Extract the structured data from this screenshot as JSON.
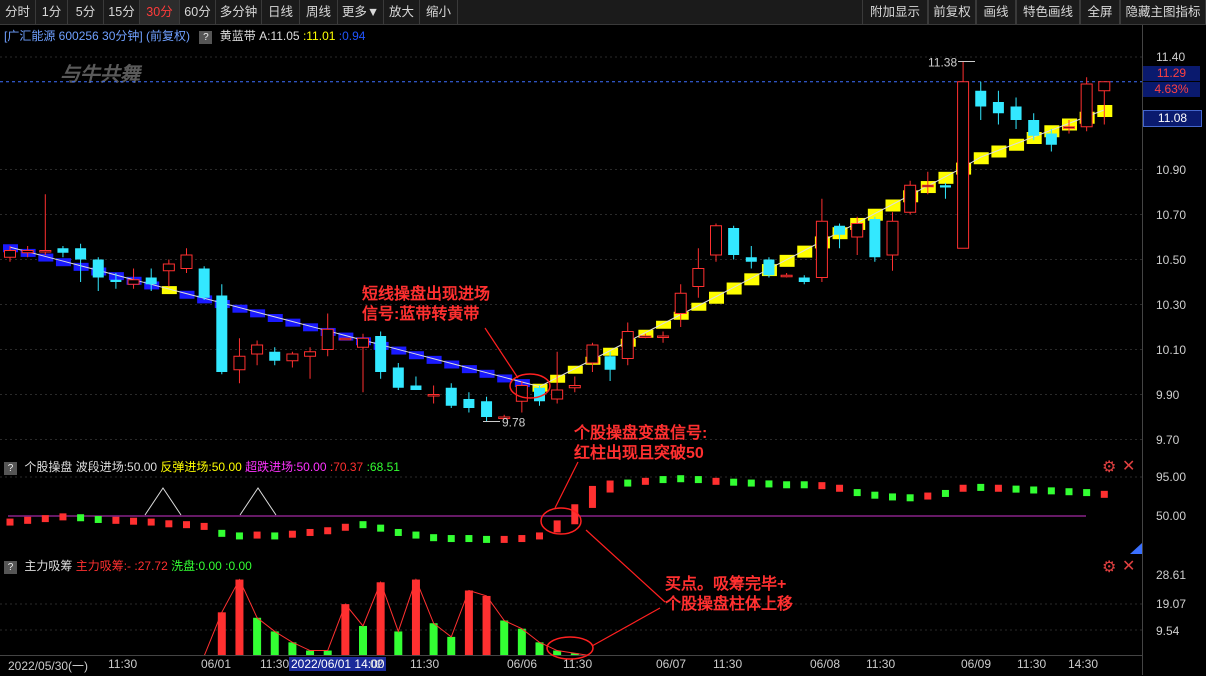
{
  "toolbar": {
    "left": [
      "分时",
      "1分",
      "5分",
      "15分",
      "30分",
      "60分",
      "多分钟",
      "日线",
      "周线",
      "更多▼",
      "放大",
      "缩小"
    ],
    "right": [
      "附加显示",
      "前复权",
      "画线",
      "特色画线",
      "全屏",
      "隐藏主图指标"
    ],
    "active": "30分"
  },
  "main": {
    "stock_label": "[广汇能源 600256 30分钟] (前复权)",
    "indicator_name": "黄蓝带",
    "indicator_a": "A:11.05",
    "indicator_b": ":11.01",
    "indicator_c": ":0.94",
    "watermark": "与牛共舞",
    "high_label": "11.38",
    "low_label": "9.78",
    "annotation": [
      "短线操盘出现进场",
      "信号:蓝带转黄带"
    ]
  },
  "price_axis": {
    "ticks": [
      "11.40",
      "10.90",
      "10.70",
      "10.50",
      "10.30",
      "10.10",
      "9.90",
      "9.70"
    ],
    "current_price": "11.29",
    "current_pct": "4.63%",
    "cursor_price": "11.08"
  },
  "sub1": {
    "name": "个股操盘",
    "l1": "波段进场:50.00",
    "l2": "反弹进场:50.00",
    "l3": "超跌进场:50.00",
    "l4": ":70.37",
    "l5": ":68.51",
    "ticks": [
      "95.00",
      "50.00"
    ],
    "annotation": [
      "个股操盘变盘信号:",
      "红柱出现且突破50"
    ]
  },
  "sub2": {
    "name": "主力吸筹",
    "l1": "主力吸筹:-",
    "l2": ":27.72",
    "l3": "洗盘:0.00",
    "l4": ":0.00",
    "ticks": [
      "28.61",
      "19.07",
      "9.54"
    ],
    "annotation": [
      "买点。吸筹完毕+",
      "个股操盘柱体上移"
    ]
  },
  "dates": [
    "2022/05/30(一)",
    "11:30",
    "06/01",
    "11:30",
    "2022/06/01 14:00",
    "02",
    "11:30",
    "06/06",
    "11:30",
    "06/07",
    "11:30",
    "06/08",
    "11:30",
    "06/09",
    "11:30",
    "14:30"
  ],
  "colors": {
    "up": "#ff3030",
    "down": "#33e8ff",
    "yellow": "#ffff00",
    "blue": "#1a1aff",
    "green": "#33ff33",
    "magenta": "#cc33cc"
  },
  "icons": [
    "gear-icon",
    "close-icon",
    "question-icon"
  ]
}
